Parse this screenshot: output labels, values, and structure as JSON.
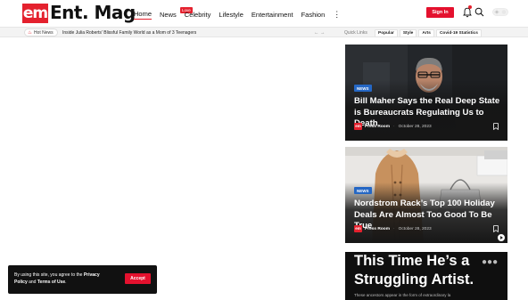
{
  "brand": {
    "logo_mark": "em",
    "name": "Ent. Mag",
    "accent": "#e4212e"
  },
  "nav": {
    "items": [
      {
        "label": "Home"
      },
      {
        "label": "News",
        "badge": "Love"
      },
      {
        "label": "Celebrity"
      },
      {
        "label": "Lifestyle"
      },
      {
        "label": "Entertainment"
      },
      {
        "label": "Fashion"
      }
    ],
    "more": "⋮"
  },
  "header": {
    "signin_label": "Sign In",
    "bell_icon": "bell-icon",
    "search_icon": "search-icon",
    "toggle_icon": "theme-toggle-icon"
  },
  "hot_news": {
    "label": "Hot News",
    "headline": "Inside Julia Roberts' Blissful Family World as a Mom of 3 Teenagers",
    "arrows": "←  →"
  },
  "quick_links": {
    "label": "Quick Links",
    "items": [
      "Popular",
      "Style",
      "Arts",
      "Covid-19 Statistics"
    ]
  },
  "articles": [
    {
      "category": "NEWS",
      "title": "Bill Maher Says the Real Deep State is Bureaucrats Regulating Us to Death",
      "author_logo": "em",
      "author": "Press Room",
      "separator": "·",
      "date": "October 28, 2023"
    },
    {
      "category": "NEWS",
      "title": "Nordstrom Rack’s Top 100 Holiday Deals Are Almost Too Good To Be True",
      "author_logo": "em",
      "author": "Press Room",
      "separator": "·",
      "date": "October 28, 2023"
    }
  ],
  "feature": {
    "title": "This Time He’s a Struggling Artist.",
    "subtitle": "These ancestors appear in the form of extraordinary la",
    "more": "●●●"
  },
  "cookie": {
    "text_prefix": "By using this site, you agree to the ",
    "link1": "Privacy Policy",
    "text_mid": " and ",
    "link2": "Terms of Use",
    "text_suffix": ".",
    "accept_label": "Accept"
  },
  "colors": {
    "badge_blue": "#2567c4",
    "dark_card": "#1c1c1c"
  }
}
